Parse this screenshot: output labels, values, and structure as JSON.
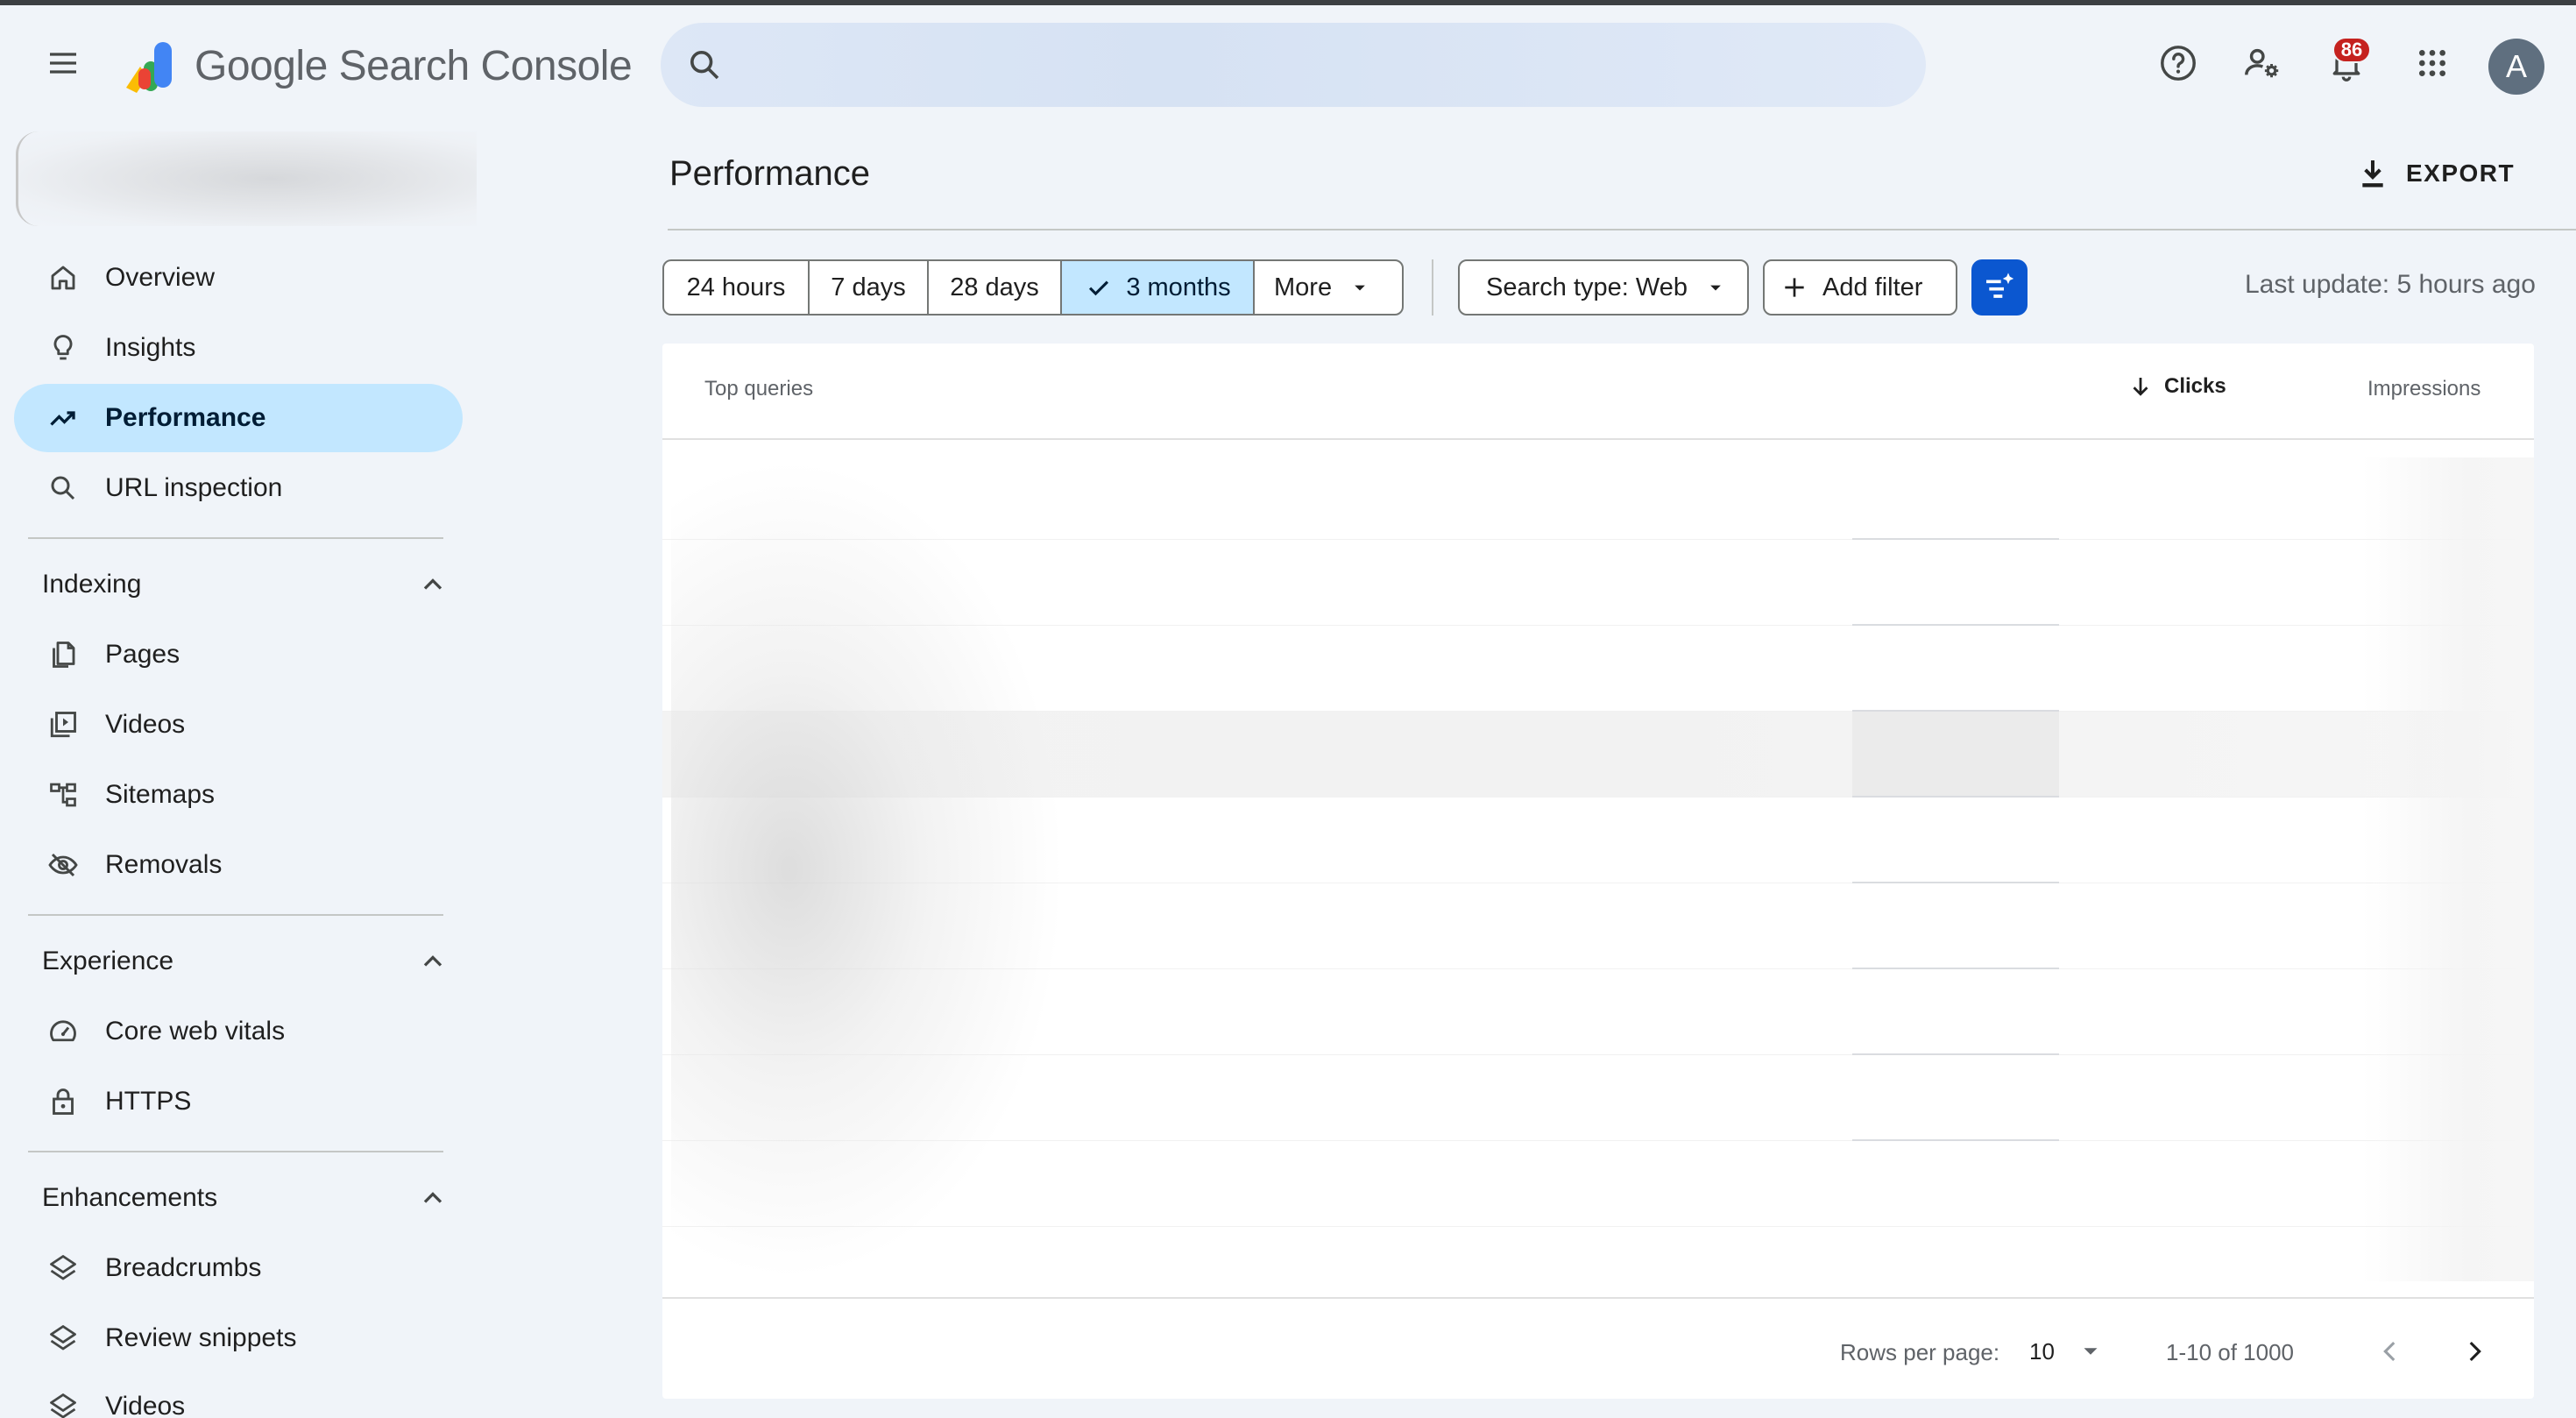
{
  "header": {
    "product_name": "Google Search Console",
    "notification_count": "86",
    "avatar_letter": "A"
  },
  "sidebar": {
    "items": [
      {
        "label": "Overview",
        "icon": "home-icon"
      },
      {
        "label": "Insights",
        "icon": "lightbulb-icon"
      },
      {
        "label": "Performance",
        "icon": "trending-up-icon",
        "active": true
      },
      {
        "label": "URL inspection",
        "icon": "search-icon"
      }
    ],
    "sections": [
      {
        "title": "Indexing",
        "items": [
          {
            "label": "Pages",
            "icon": "pages-icon"
          },
          {
            "label": "Videos",
            "icon": "video-icon"
          },
          {
            "label": "Sitemaps",
            "icon": "sitemap-icon"
          },
          {
            "label": "Removals",
            "icon": "eye-off-icon"
          }
        ]
      },
      {
        "title": "Experience",
        "items": [
          {
            "label": "Core web vitals",
            "icon": "speedometer-icon"
          },
          {
            "label": "HTTPS",
            "icon": "lock-icon"
          }
        ]
      },
      {
        "title": "Enhancements",
        "items": [
          {
            "label": "Breadcrumbs",
            "icon": "layers-icon"
          },
          {
            "label": "Review snippets",
            "icon": "layers-icon"
          },
          {
            "label": "Videos",
            "icon": "layers-icon"
          }
        ]
      }
    ]
  },
  "main": {
    "title": "Performance",
    "export_label": "EXPORT",
    "date_ranges": [
      "24 hours",
      "7 days",
      "28 days",
      "3 months",
      "More"
    ],
    "selected_range": "3 months",
    "search_type_label": "Search type: Web",
    "add_filter_label": "Add filter",
    "last_update": "Last update: 5 hours ago"
  },
  "table": {
    "col_queries": "Top queries",
    "col_clicks": "Clicks",
    "col_impressions": "Impressions",
    "rows_per_page_label": "Rows per page:",
    "rows_per_page_value": "10",
    "range_label": "1-10 of 1000"
  },
  "colors": {
    "accent": "#0b57d0",
    "active_nav": "#c2e7ff",
    "background": "#f0f4f9",
    "badge": "#c5221f"
  }
}
